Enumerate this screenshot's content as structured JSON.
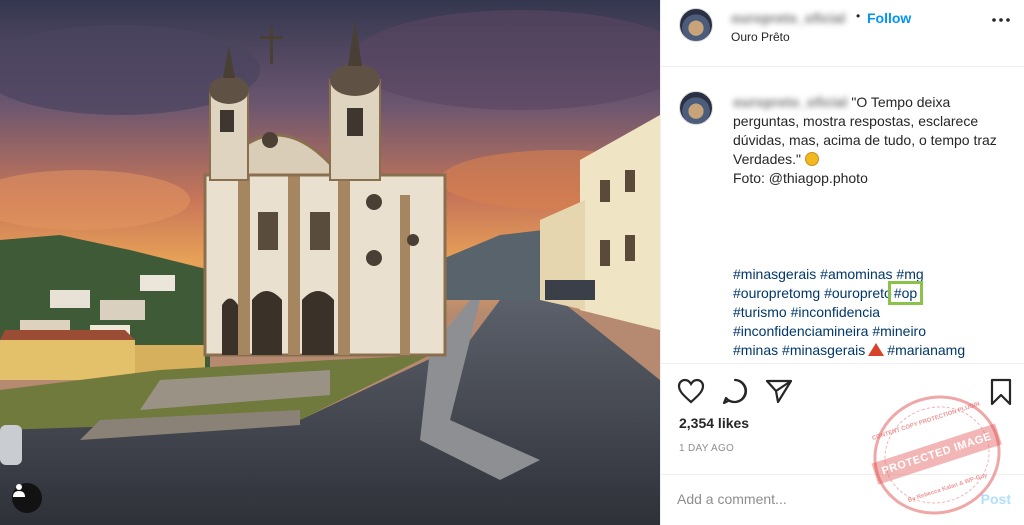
{
  "header": {
    "username": "ouropreto_oficial",
    "separator": "•",
    "follow_label": "Follow",
    "location": "Ouro Prêto"
  },
  "caption": {
    "username": "ouropreto_oficial",
    "text": "\"O Tempo deixa perguntas, mostra respostas, esclarece dúvidas, mas, acima de tudo, o tempo traz Verdades.\"",
    "credit": "Foto: @thiagop.photo"
  },
  "hashtags": {
    "line1": [
      "#minasgerais",
      "#amominas",
      "#mg"
    ],
    "line2": [
      "#ouropretomg",
      "#ouropreto"
    ],
    "highlighted": "#op",
    "line3": [
      "#turismo",
      "#inconfidencia"
    ],
    "line4": [
      "#inconfidenciamineira",
      "#mineiro"
    ],
    "line5_before": [
      "#minas",
      "#minasgerais"
    ],
    "line5_after": [
      "#marianamg"
    ]
  },
  "actions": {
    "like_icon": "heart-icon",
    "comment_icon": "comment-icon",
    "share_icon": "paper-plane-icon",
    "save_icon": "bookmark-icon",
    "likes": "2,354 likes",
    "time": "1 DAY AGO"
  },
  "comment": {
    "placeholder": "Add a comment...",
    "post_label": "Post"
  },
  "watermark": {
    "band": "PROTECTED IMAGE",
    "top": "CONTENT COPY PROTECTION PLUGIN",
    "bottom": "By Rebecca Kalan & WP-Guy"
  },
  "colors": {
    "link": "#0095f6",
    "hashtag": "#00376b",
    "highlight": "#8bc34a",
    "muted": "#8e8e8e"
  }
}
